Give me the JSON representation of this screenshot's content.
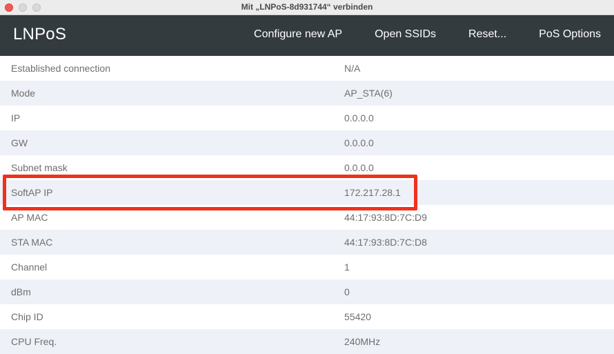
{
  "window": {
    "title": "Mit „LNPoS-8d931744“ verbinden"
  },
  "navbar": {
    "brand": "LNPoS",
    "links": [
      "Configure new AP",
      "Open SSIDs",
      "Reset...",
      "PoS Options"
    ]
  },
  "info_table": {
    "rows": [
      {
        "label": "Established connection",
        "value": "N/A"
      },
      {
        "label": "Mode",
        "value": "AP_STA(6)"
      },
      {
        "label": "IP",
        "value": "0.0.0.0"
      },
      {
        "label": "GW",
        "value": "0.0.0.0"
      },
      {
        "label": "Subnet mask",
        "value": "0.0.0.0"
      },
      {
        "label": "SoftAP IP",
        "value": "172.217.28.1"
      },
      {
        "label": "AP MAC",
        "value": "44:17:93:8D:7C:D9"
      },
      {
        "label": "STA MAC",
        "value": "44:17:93:8D:7C:D8"
      },
      {
        "label": "Channel",
        "value": "1"
      },
      {
        "label": "dBm",
        "value": "0"
      },
      {
        "label": "Chip ID",
        "value": "55420"
      },
      {
        "label": "CPU Freq.",
        "value": "240MHz"
      }
    ]
  },
  "colors": {
    "navbar_bg": "#333b3f",
    "highlight": "#f0301c",
    "row_stripe": "#eef1f7"
  }
}
